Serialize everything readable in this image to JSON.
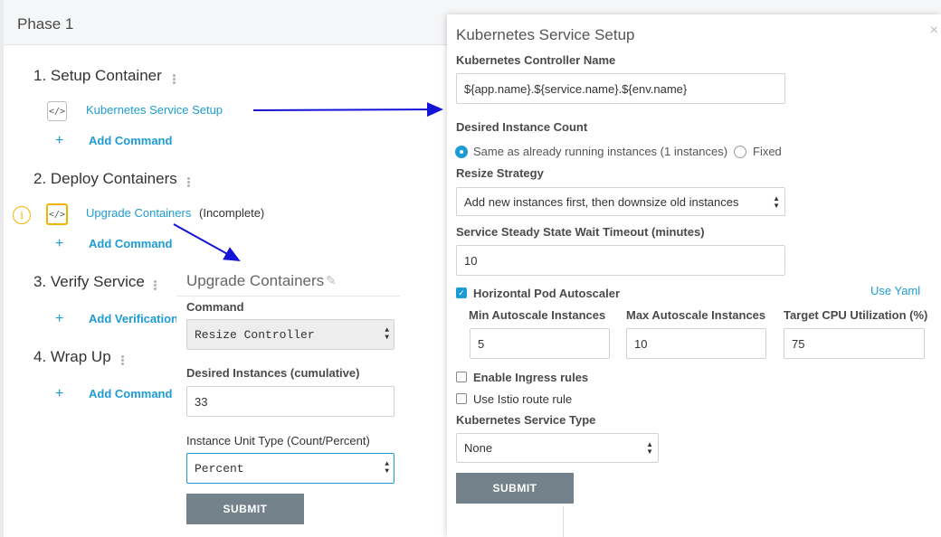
{
  "phase": {
    "title": "Phase 1"
  },
  "steps": [
    {
      "title": "1. Setup Container",
      "command": "Kubernetes Service Setup",
      "add_label": "Add Command"
    },
    {
      "title": "2. Deploy Containers",
      "command": "Upgrade Containers",
      "status": "(Incomplete)",
      "add_label": "Add Command"
    },
    {
      "title": "3. Verify Service",
      "add_label": "Add Verification"
    },
    {
      "title": "4. Wrap Up",
      "add_label": "Add Command"
    }
  ],
  "icons": {
    "command": "</>",
    "warning": "i",
    "plus": "+",
    "close": "×",
    "checkmark": "✓"
  },
  "k8s_dialog": {
    "title": "Kubernetes Service Setup",
    "controller_name_label": "Kubernetes Controller Name",
    "controller_name_value": "${app.name}.${service.name}.${env.name}",
    "instance_count_label": "Desired Instance Count",
    "radio_same_label": "Same as already running instances (1 instances)",
    "radio_fixed_label": "Fixed",
    "resize_strategy_label": "Resize Strategy",
    "resize_strategy_value": "Add new instances first, then downsize old instances",
    "timeout_label": "Service Steady State Wait Timeout (minutes)",
    "timeout_value": "10",
    "hpa_label": "Horizontal Pod Autoscaler",
    "use_yaml_label": "Use Yaml",
    "min_label": "Min Autoscale Instances",
    "min_value": "5",
    "max_label": "Max Autoscale Instances",
    "max_value": "10",
    "cpu_label": "Target CPU Utilization (%)",
    "cpu_value": "75",
    "ingress_label": "Enable Ingress rules",
    "istio_label": "Use Istio route rule",
    "service_type_label": "Kubernetes Service Type",
    "service_type_value": "None",
    "submit_label": "SUBMIT"
  },
  "upgrade_dialog": {
    "title": "Upgrade Containers",
    "command_label": "Command",
    "command_value": "Resize Controller",
    "desired_label": "Desired Instances (cumulative)",
    "desired_value": "33",
    "unit_label": "Instance Unit Type (Count/Percent)",
    "unit_value": "Percent",
    "submit_label": "SUBMIT"
  },
  "colors": {
    "link": "#1d9cd3",
    "warning": "#f0b400",
    "button": "#74828b",
    "arrow": "#1414d8"
  }
}
